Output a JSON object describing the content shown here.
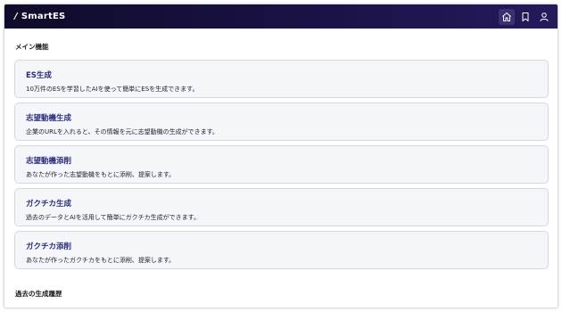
{
  "header": {
    "brand_slash": "/",
    "brand_name": "SmartES",
    "icons": [
      "home-icon",
      "bookmark-icon",
      "user-icon"
    ]
  },
  "main": {
    "section_title": "メイン機能",
    "cards": [
      {
        "title": "ES生成",
        "description": "10万件のESを学習したAIを使って簡単にESを生成できます。"
      },
      {
        "title": "志望動機生成",
        "description": "企業のURLを入れると、その情報を元に志望動機の生成ができます。"
      },
      {
        "title": "志望動機添削",
        "description": "あなたが作った志望動機をもとに添削、提案します。"
      },
      {
        "title": "ガクチカ生成",
        "description": "過去のデータとAIを活用して簡単にガクチカ生成ができます。"
      },
      {
        "title": "ガクチカ添削",
        "description": "あなたが作ったガクチカをもとに添削、提案します。"
      }
    ],
    "history_title": "過去の生成履歴"
  },
  "colors": {
    "header_bg": "#140f35",
    "accent": "#2a2d7a",
    "card_bg": "#f5f6fa",
    "card_border": "#d5d8e2"
  }
}
